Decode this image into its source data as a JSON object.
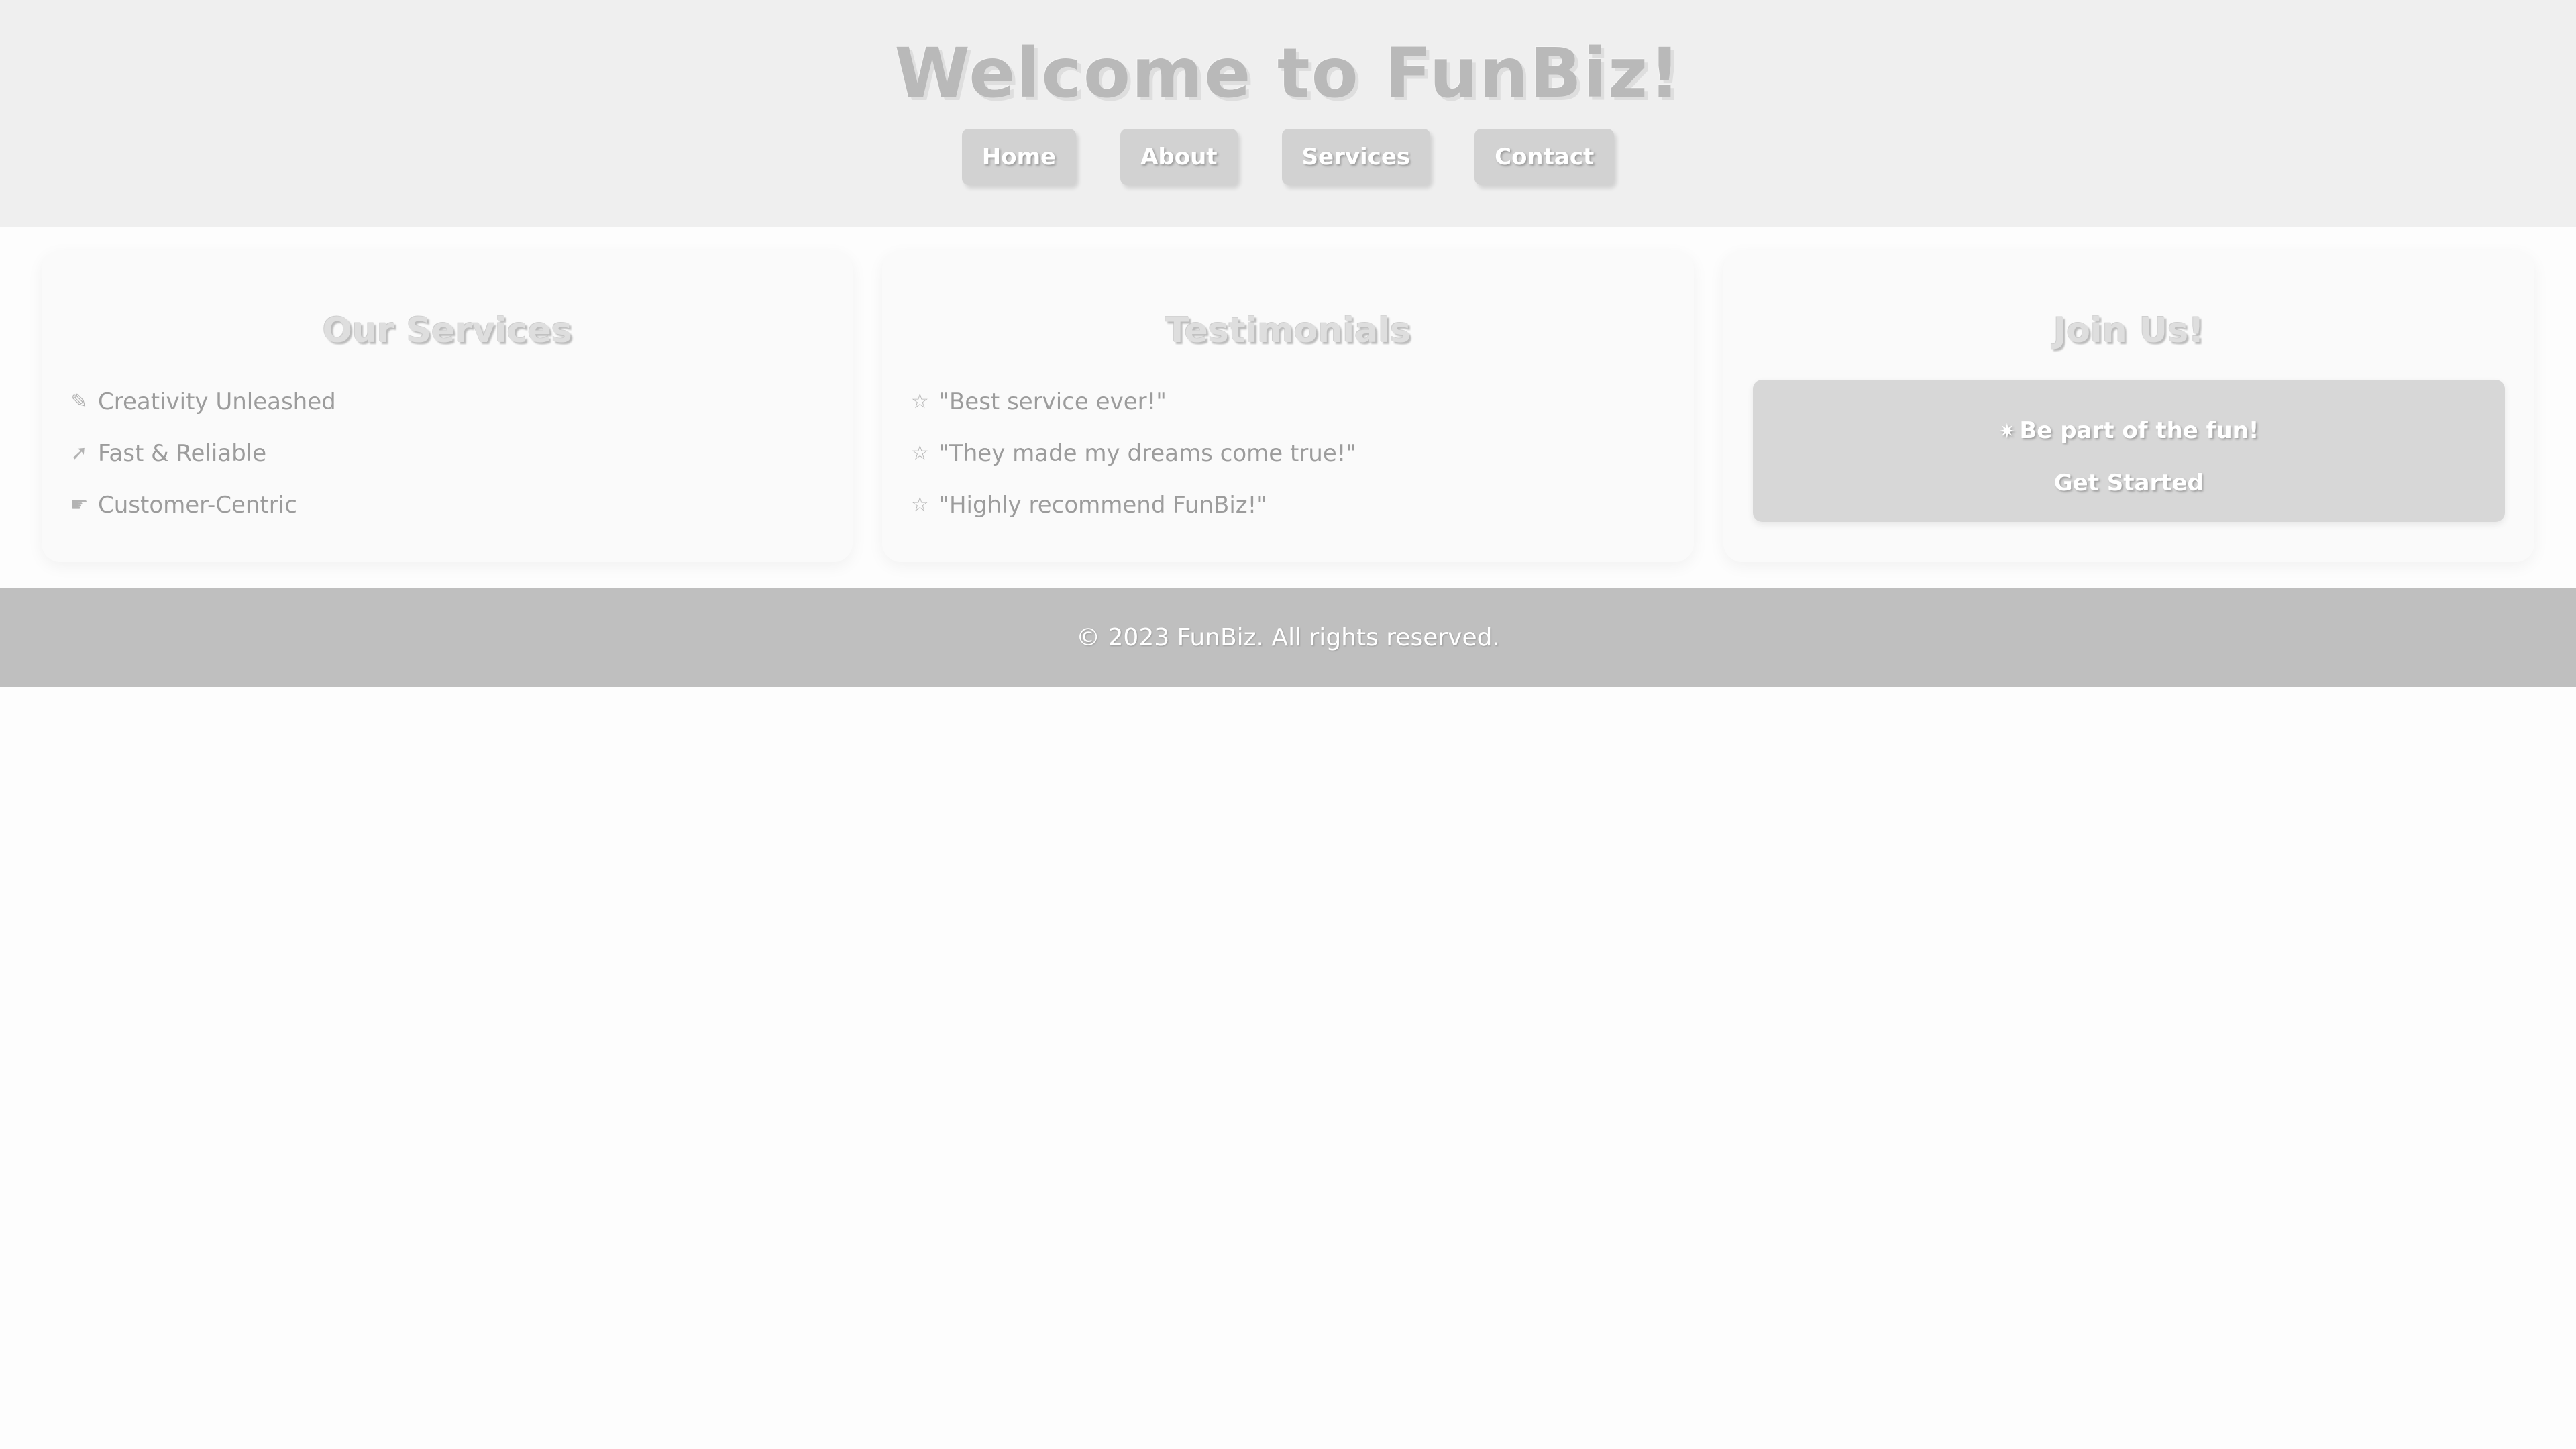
{
  "header": {
    "title": "Welcome to FunBiz!",
    "nav": [
      {
        "label": "Home"
      },
      {
        "label": "About"
      },
      {
        "label": "Services"
      },
      {
        "label": "Contact"
      }
    ]
  },
  "services": {
    "title": "Our Services",
    "items": [
      {
        "icon": "palette-icon",
        "text": "Creativity Unleashed"
      },
      {
        "icon": "rocket-icon",
        "text": "Fast & Reliable"
      },
      {
        "icon": "handshake-icon",
        "text": "Customer-Centric"
      }
    ]
  },
  "testimonials": {
    "title": "Testimonials",
    "items": [
      {
        "icon": "star-icon",
        "text": "\"Best service ever!\""
      },
      {
        "icon": "star-icon",
        "text": "\"They made my dreams come true!\""
      },
      {
        "icon": "star-icon",
        "text": "\"Highly recommend FunBiz!\""
      }
    ]
  },
  "join": {
    "title": "Join Us!",
    "icon": "sparkle-icon",
    "tagline": "Be part of the fun!",
    "cta_label": "Get Started"
  },
  "footer": {
    "text": "© 2023 FunBiz. All rights reserved."
  },
  "colors": {
    "header_bg": "#efefef",
    "nav_button_bg": "#d2d2d2",
    "card_bg": "#fafafa",
    "join_box_bg": "#d7d7d7",
    "footer_bg": "#bfbfbf",
    "page_bg": "#fdfdfd"
  }
}
